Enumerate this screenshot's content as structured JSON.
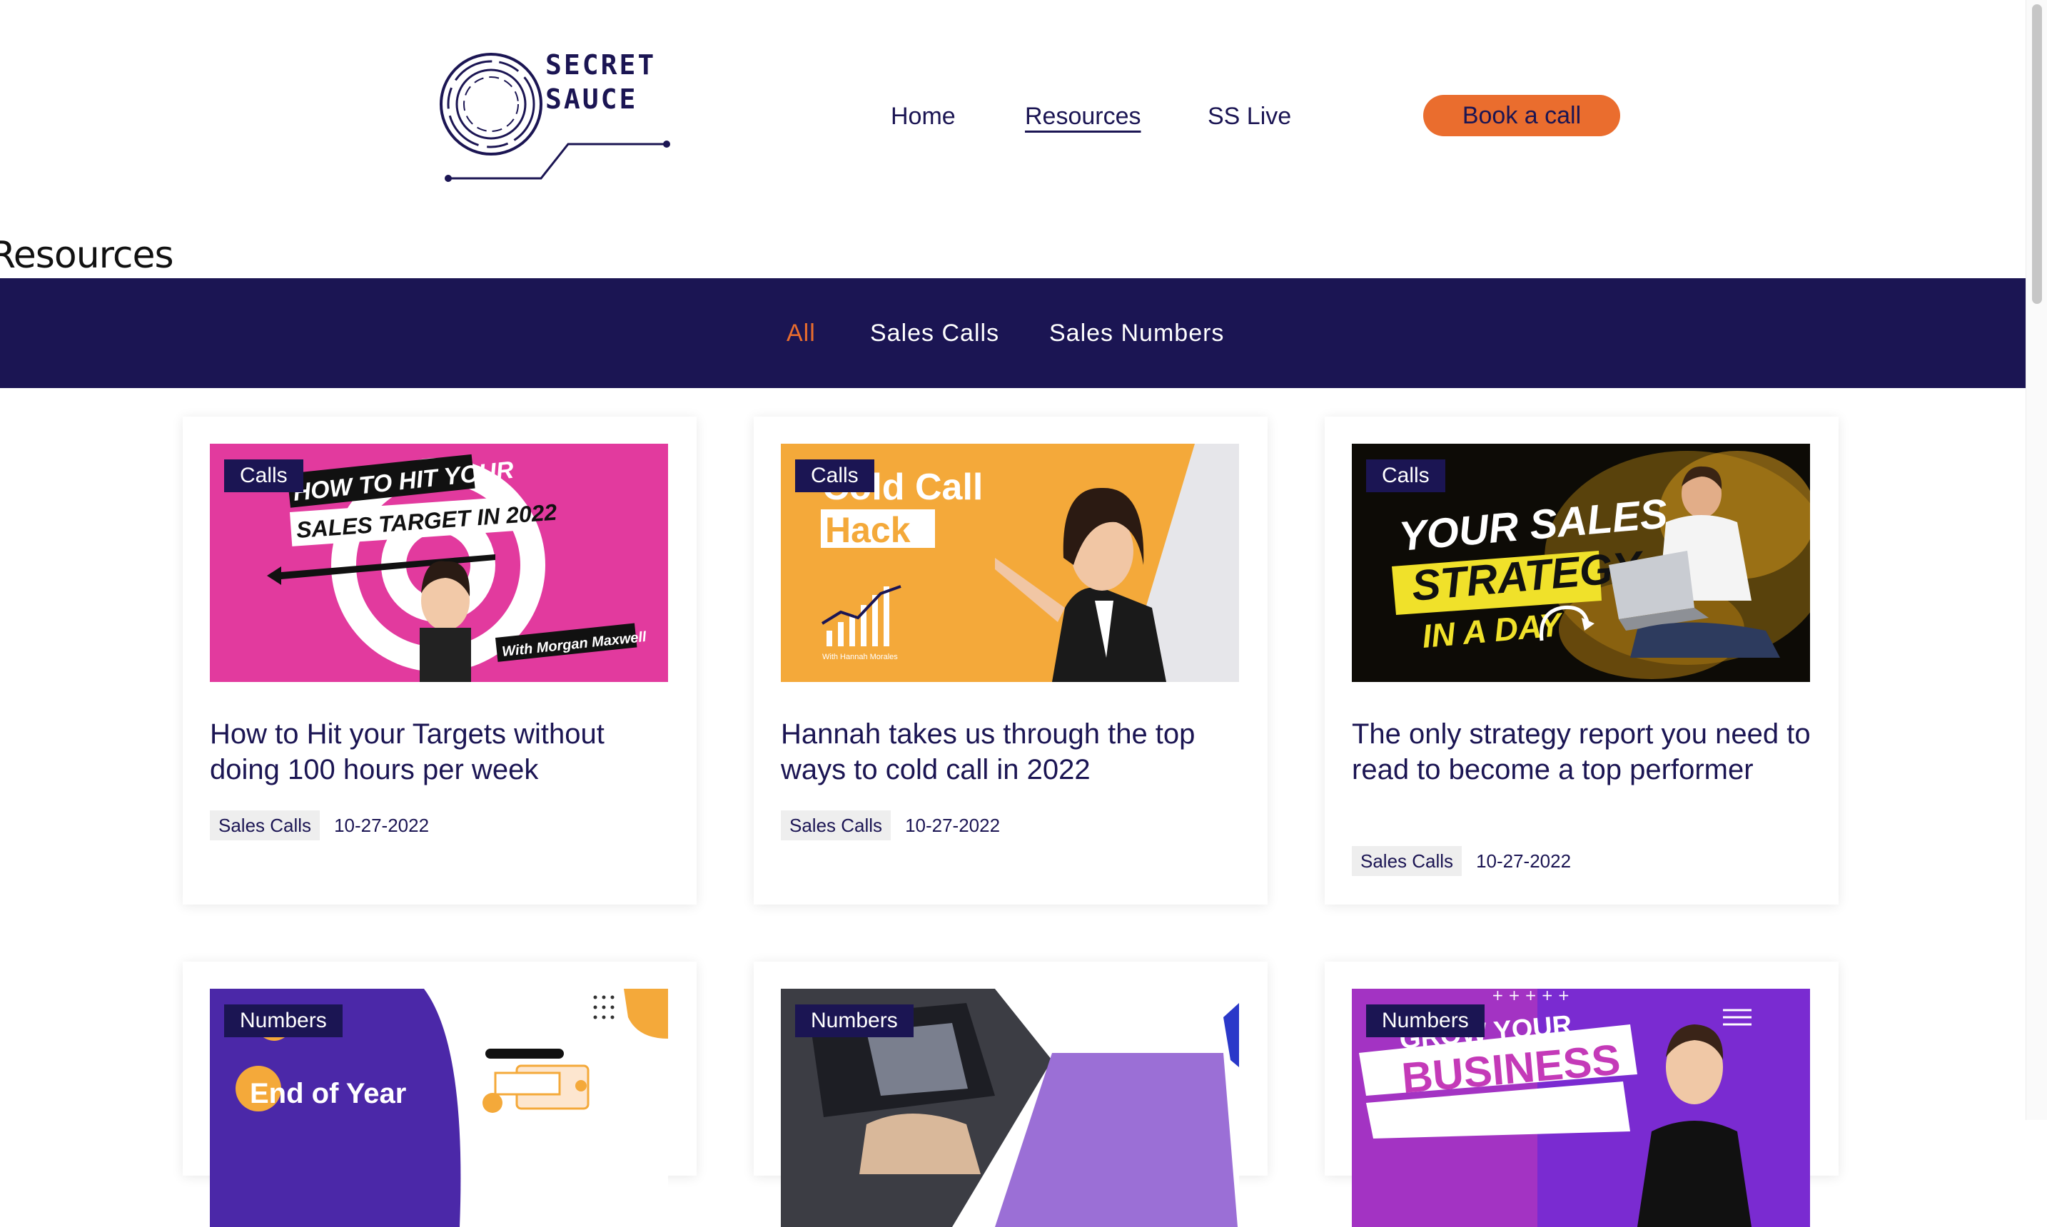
{
  "logo": {
    "line1": "SECRET",
    "line2": "SAUCE"
  },
  "nav": {
    "items": [
      {
        "label": "Home"
      },
      {
        "label": "Resources"
      },
      {
        "label": "SS Live"
      }
    ],
    "active": "Resources",
    "cta_label": "Book a call"
  },
  "page": {
    "title": "Resources"
  },
  "filters": {
    "items": [
      {
        "label": "All"
      },
      {
        "label": "Sales Calls"
      },
      {
        "label": "Sales Numbers"
      }
    ],
    "active": "All"
  },
  "cards": [
    {
      "badge": "Calls",
      "title": "How to Hit your Targets without doing 100 hours per week",
      "category": "Sales Calls",
      "date": "10-27-2022",
      "image_text": [
        "HOW TO HIT YOUR",
        "SALES TARGET IN 2022",
        "With Morgan Maxwell"
      ]
    },
    {
      "badge": "Calls",
      "title": "Hannah takes us through the top ways to cold call in 2022",
      "category": "Sales Calls",
      "date": "10-27-2022",
      "image_text": [
        "Cold Call",
        "Hack",
        "With Hannah Morales"
      ]
    },
    {
      "badge": "Calls",
      "title": "The only strategy report you need to read to become a top performer",
      "category": "Sales Calls",
      "date": "10-27-2022",
      "image_text": [
        "YOUR SALES",
        "STRATEGY",
        "IN A DAY"
      ]
    },
    {
      "badge": "Numbers",
      "image_text": [
        "End of Year"
      ]
    },
    {
      "badge": "Numbers",
      "image_text": []
    },
    {
      "badge": "Numbers",
      "image_text": [
        "GROW YOUR",
        "BUSINESS"
      ]
    }
  ],
  "colors": {
    "brand_navy": "#1b1553",
    "accent_orange": "#ea6d2e",
    "white": "#ffffff"
  }
}
